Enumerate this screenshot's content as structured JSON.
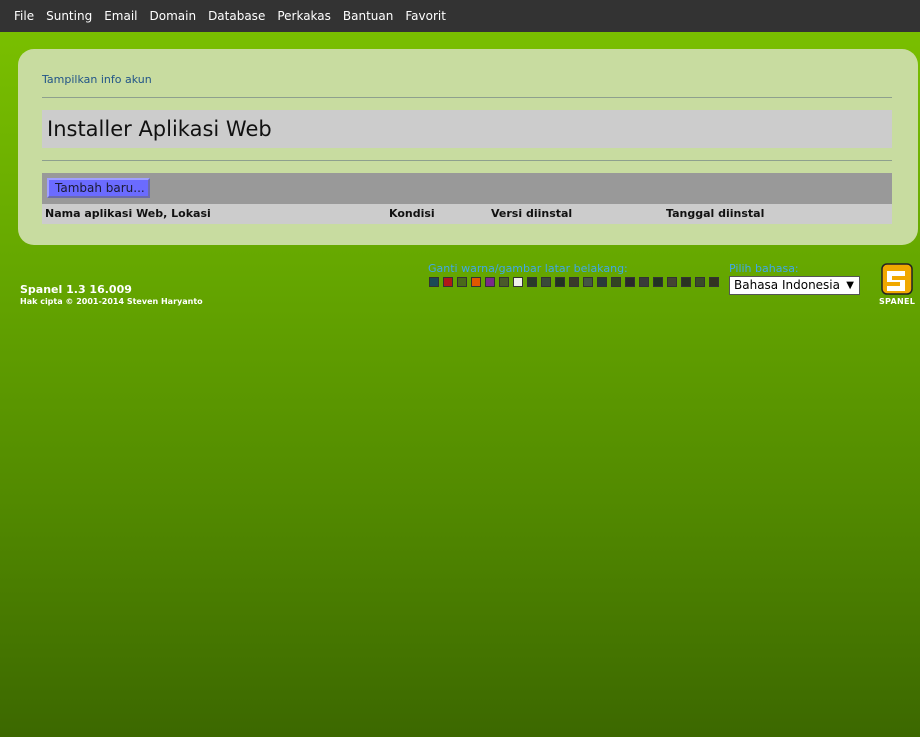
{
  "menu": [
    "File",
    "Sunting",
    "Email",
    "Domain",
    "Database",
    "Perkakas",
    "Bantuan",
    "Favorit"
  ],
  "panel": {
    "account_link": "Tampilkan info akun",
    "title": "Installer Aplikasi Web",
    "add_button": "Tambah baru...",
    "columns": [
      "Nama aplikasi Web, Lokasi",
      "Kondisi",
      "Versi diinstal",
      "Tanggal diinstal"
    ]
  },
  "footer": {
    "version": "Spanel 1.3 16.009",
    "copyright": "Hak cipta © 2001-2014 Steven Haryanto",
    "background_label": "Ganti warna/gambar latar belakang:",
    "language_label": "Pilih bahasa:",
    "language_selected": "Bahasa Indonesia",
    "logo_text": "SPANEL"
  },
  "swatch_colors": [
    "#1c4a56",
    "#b01818",
    "#4a6a1a",
    "#e05800",
    "#7a2a8a",
    "#4a5a2a",
    "#f0f0e8",
    "#2a3a2a",
    "#3a4a3a",
    "#223322",
    "#3a3a2a",
    "#445544",
    "#2a3a3a",
    "#334422",
    "#2a2a2a",
    "#3a3a3a",
    "#223322",
    "#444433",
    "#2a3322",
    "#3a4a2a",
    "#333322"
  ],
  "colors": {
    "menubar": "#333333",
    "panel": "#c8dca0",
    "add_button": "#6b6bff",
    "link": "#225588",
    "footer_label": "#3fa8e8"
  }
}
